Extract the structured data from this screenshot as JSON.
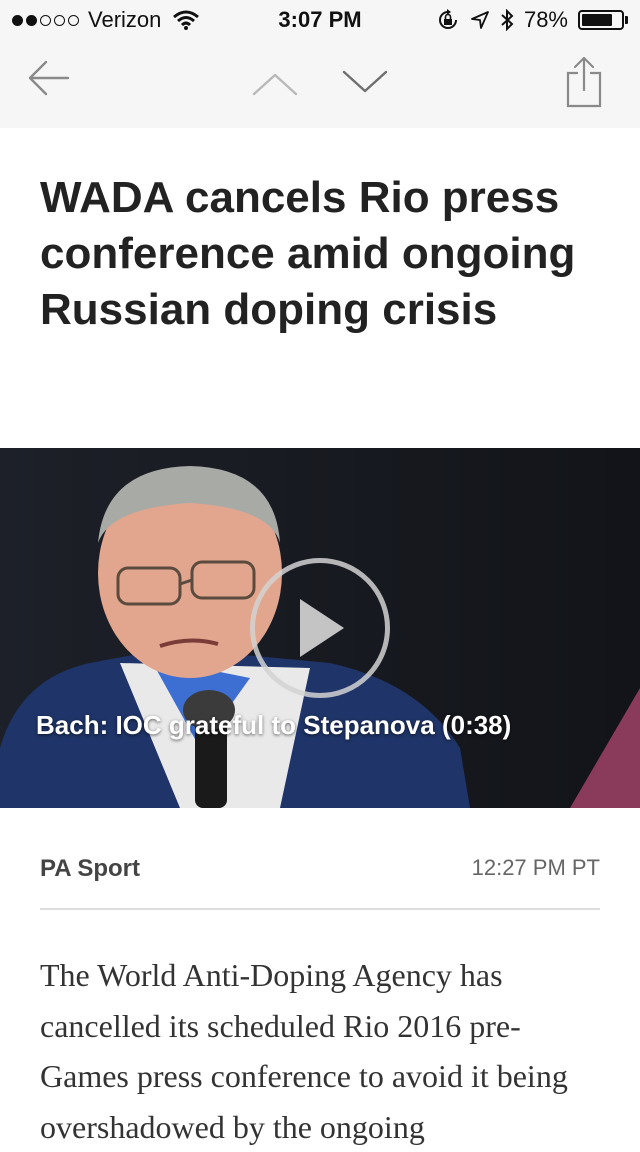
{
  "status_bar": {
    "carrier": "Verizon",
    "time": "3:07 PM",
    "battery_percent": "78%",
    "battery_level": 0.78,
    "signal_bars_filled": 2,
    "signal_bars_total": 5
  },
  "nav": {
    "back_icon": "arrow-left-icon",
    "prev_icon": "chevron-up-icon",
    "next_icon": "chevron-down-icon",
    "share_icon": "share-icon"
  },
  "article": {
    "headline": "WADA cancels Rio press conference amid ongoing Russian doping crisis",
    "video": {
      "caption": "Bach: IOC grateful to Stepanova (0:38)"
    },
    "source": "PA Sport",
    "timestamp": "12:27 PM PT",
    "body": "The World Anti-Doping Agency has cancelled its scheduled Rio 2016 pre-Games press conference to avoid it being overshadowed by the ongoing"
  }
}
